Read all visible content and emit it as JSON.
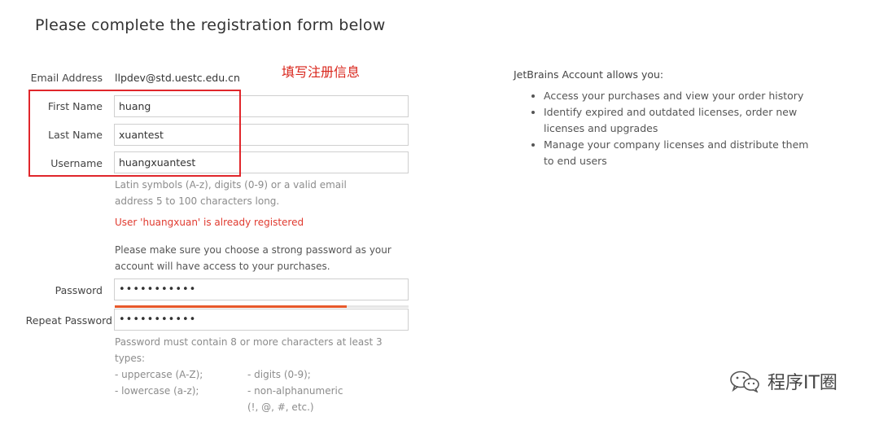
{
  "page": {
    "title": "Please complete the registration form below",
    "annotation": "填写注册信息"
  },
  "form": {
    "email": {
      "label": "Email Address",
      "value": "llpdev@std.uestc.edu.cn"
    },
    "first_name": {
      "label": "First Name",
      "value": "huang"
    },
    "last_name": {
      "label": "Last Name",
      "value": "xuantest"
    },
    "username": {
      "label": "Username",
      "value": "huangxuantest",
      "hint_line1": "Latin symbols (A-z), digits (0-9) or a valid email",
      "hint_line2": "address 5 to 100 characters long.",
      "error": "User 'huangxuan' is already registered"
    },
    "password_note_line1": "Please make sure you choose a strong password as your",
    "password_note_line2": "account will have access to your purchases.",
    "password": {
      "label": "Password",
      "value": "•••••••••••"
    },
    "repeat_password": {
      "label": "Repeat Password",
      "value": "•••••••••••"
    },
    "strength": {
      "fraction": 0.79,
      "color": "#e8592b"
    },
    "requirements": {
      "line1": "Password must contain 8 or more characters at least 3",
      "line2": "types:",
      "uppercase": "- uppercase (A-Z);",
      "lowercase": "- lowercase (a-z);",
      "digits": "- digits (0-9);",
      "nonalpha": "- non-alphanumeric",
      "nonalpha_examples": "(!, @, #, etc.)"
    }
  },
  "account_info": {
    "title": "JetBrains Account allows you:",
    "items": [
      "Access your purchases and view your order history",
      "Identify expired and outdated licenses, order new licenses and upgrades",
      "Manage your company licenses and distribute them to end users"
    ]
  },
  "watermark": {
    "text": "程序IT圈",
    "icon": "wechat-icon"
  },
  "colors": {
    "highlight_box": "#e0262b",
    "error": "#e03a2f",
    "annotation": "#d9261c"
  }
}
